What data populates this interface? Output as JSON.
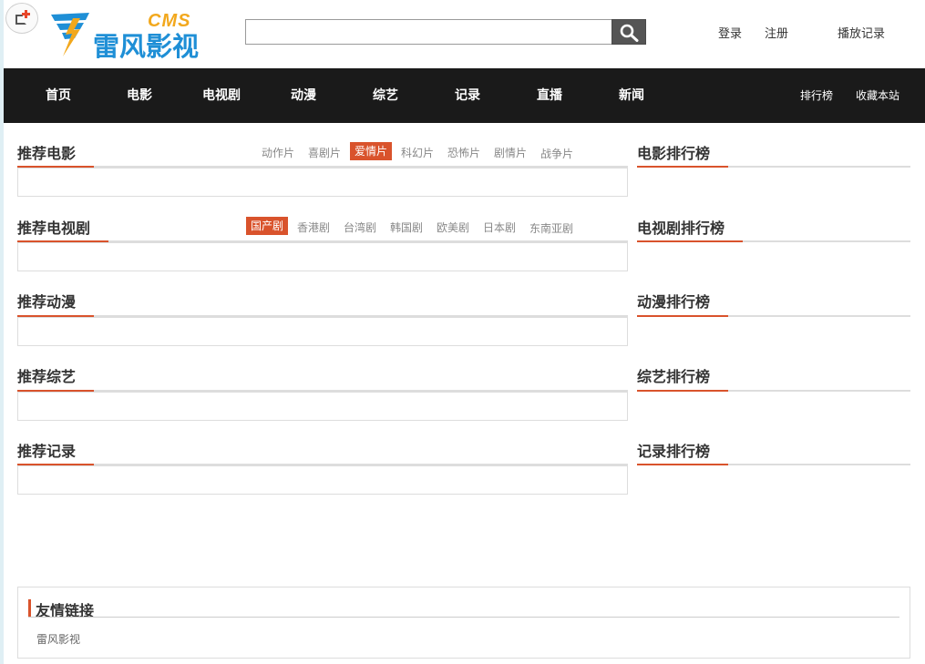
{
  "header": {
    "logo_cms": "CMS",
    "logo_name": "雷风影视",
    "search_value": "",
    "links": [
      "登录",
      "注册",
      "播放记录"
    ]
  },
  "nav": {
    "items": [
      "首页",
      "电影",
      "电视剧",
      "动漫",
      "综艺",
      "记录",
      "直播",
      "新闻"
    ],
    "right": [
      "排行榜",
      "收藏本站"
    ]
  },
  "sections": [
    {
      "title": "推荐电影",
      "tags": [
        "动作片",
        "喜剧片",
        "爱情片",
        "科幻片",
        "恐怖片",
        "剧情片",
        "战争片"
      ],
      "active_tag": "爱情片",
      "rank_title": "电影排行榜"
    },
    {
      "title": "推荐电视剧",
      "tags": [
        "国产剧",
        "香港剧",
        "台湾剧",
        "韩国剧",
        "欧美剧",
        "日本剧",
        "东南亚剧"
      ],
      "active_tag": "国产剧",
      "rank_title": "电视剧排行榜"
    },
    {
      "title": "推荐动漫",
      "tags": [],
      "rank_title": "动漫排行榜"
    },
    {
      "title": "推荐综艺",
      "tags": [],
      "rank_title": "综艺排行榜"
    },
    {
      "title": "推荐记录",
      "tags": [],
      "rank_title": "记录排行榜"
    }
  ],
  "friend_links": {
    "title": "友情链接",
    "items": [
      "雷风影视"
    ]
  },
  "colors": {
    "accent": "#d9532c",
    "nav_bg": "#1a1a1a",
    "logo_blue": "#1f8fd6",
    "logo_orange": "#f2a81d"
  }
}
